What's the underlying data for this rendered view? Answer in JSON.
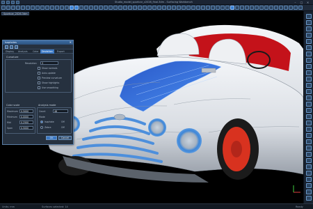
{
  "titlebar": {
    "title": "Studio_model_sportcar_v2026_final.3dm - Surfacing Workbench",
    "minimize": "–",
    "maximize": "□",
    "close": "×"
  },
  "document_tab": "Sportcar_2026.3dm",
  "dialog": {
    "title": "Isophotes",
    "close": "×",
    "tabs": [
      "Display",
      "Analysis",
      "Color",
      "Deviation",
      "Export"
    ],
    "active_tab": 3,
    "group1": {
      "title": "Curvature",
      "field_label": "Resolution",
      "field_value": "3",
      "options": [
        "Show normals",
        "Auto-update",
        "Preview curvature",
        "Show highlights",
        "Use smoothing"
      ]
    },
    "group2": {
      "title": "Color scale",
      "rows": [
        {
          "label": "Maximum",
          "value": "0.5000"
        },
        {
          "label": "Minimum",
          "value": "0.0000"
        },
        {
          "label": "Mid",
          "value": "0.2500"
        },
        {
          "label": "Span",
          "value": "0.5000"
        }
      ]
    },
    "group3": {
      "title": "Analysis mode",
      "field_label": "Count",
      "field_value": "48",
      "sub_label": "Mode",
      "radios": [
        {
          "label": "Isophote",
          "value": "Off",
          "selected": true
        },
        {
          "label": "Zebra",
          "value": "Off",
          "selected": false
        }
      ]
    },
    "buttons": {
      "ok": "OK",
      "cancel": "Cancel"
    }
  },
  "statusbar": {
    "left": "Units: mm",
    "mid": "Surfaces selected: 14",
    "right": "Ready"
  },
  "colors": {
    "viewport_bg": "#000000",
    "car_body": "#e6e9ee",
    "interior": "#c4121a",
    "analysis_stripe": "#2f6fe0",
    "wheel_rim": "#d8321f",
    "accent": "#3b78c4"
  }
}
